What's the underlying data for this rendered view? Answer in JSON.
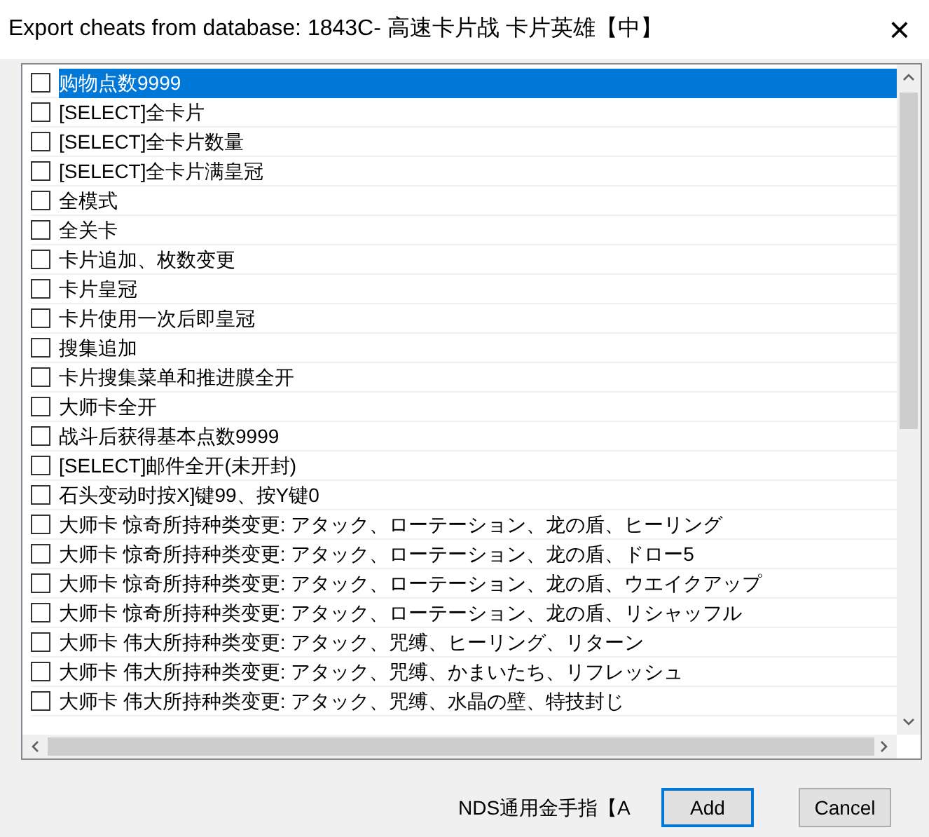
{
  "window": {
    "title": "Export cheats from database: 1843C- 高速卡片战 卡片英雄【中】",
    "close": "×"
  },
  "cheats": [
    {
      "label": "购物点数9999",
      "checked": false,
      "selected": true
    },
    {
      "label": "[SELECT]全卡片",
      "checked": false,
      "selected": false
    },
    {
      "label": "[SELECT]全卡片数量",
      "checked": false,
      "selected": false
    },
    {
      "label": "[SELECT]全卡片满皇冠",
      "checked": false,
      "selected": false
    },
    {
      "label": "全模式",
      "checked": false,
      "selected": false
    },
    {
      "label": "全关卡",
      "checked": false,
      "selected": false
    },
    {
      "label": "卡片追加、枚数变更",
      "checked": false,
      "selected": false
    },
    {
      "label": "卡片皇冠",
      "checked": false,
      "selected": false
    },
    {
      "label": "卡片使用一次后即皇冠",
      "checked": false,
      "selected": false
    },
    {
      "label": "搜集追加",
      "checked": false,
      "selected": false
    },
    {
      "label": "卡片搜集菜单和推进膜全开",
      "checked": false,
      "selected": false
    },
    {
      "label": "大师卡全开",
      "checked": false,
      "selected": false
    },
    {
      "label": "战斗后获得基本点数9999",
      "checked": false,
      "selected": false
    },
    {
      "label": "[SELECT]邮件全开(未开封)",
      "checked": false,
      "selected": false
    },
    {
      "label": "石头变动时按X]键99、按Y键0",
      "checked": false,
      "selected": false
    },
    {
      "label": "大师卡 惊奇所持种类变更: アタック、ローテーション、龙の盾、ヒーリング",
      "checked": false,
      "selected": false
    },
    {
      "label": "大师卡 惊奇所持种类变更: アタック、ローテーション、龙の盾、ドロー5",
      "checked": false,
      "selected": false
    },
    {
      "label": "大师卡 惊奇所持种类变更: アタック、ローテーション、龙の盾、ウエイクアップ",
      "checked": false,
      "selected": false
    },
    {
      "label": "大师卡 惊奇所持种类变更: アタック、ローテーション、龙の盾、リシャッフル",
      "checked": false,
      "selected": false
    },
    {
      "label": "大师卡 伟大所持种类变更: アタック、咒缚、ヒーリング、リターン",
      "checked": false,
      "selected": false
    },
    {
      "label": "大师卡 伟大所持种类变更: アタック、咒缚、かまいたち、リフレッシュ",
      "checked": false,
      "selected": false
    },
    {
      "label": "大师卡 伟大所持种类变更: アタック、咒缚、水晶の壁、特技封じ",
      "checked": false,
      "selected": false
    }
  ],
  "folder_label": "NDS通用金手指【A",
  "buttons": [
    {
      "label": "Add",
      "kind": "default"
    },
    {
      "label": "Cancel",
      "kind": "normal"
    }
  ]
}
